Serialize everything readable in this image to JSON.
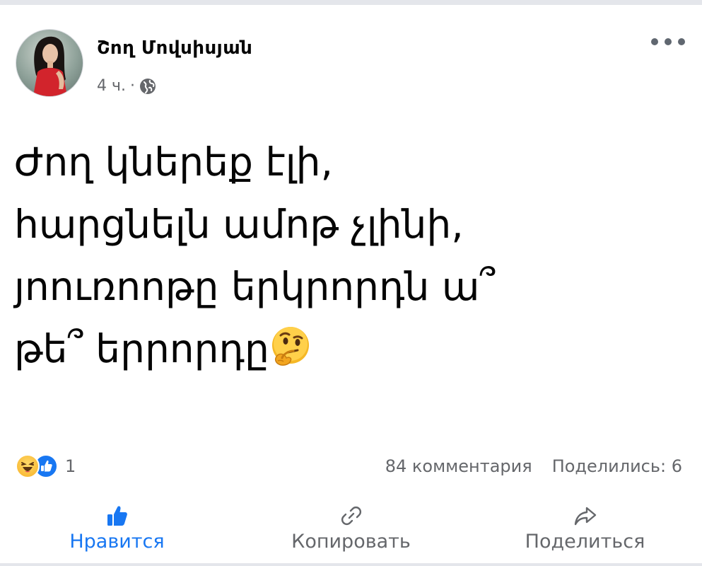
{
  "post": {
    "author": "Շող Մովսիսյան",
    "time": "4 ч.",
    "separator": "·",
    "text_lines": [
      "Ժող կներեք էլի,",
      "հարցնելն ամոթ չլինի,",
      "յոուռոոթը երկրորդն ա՞",
      "թե՞ երրորդը"
    ]
  },
  "stats": {
    "reaction_count": "1",
    "comments": "84 комментария",
    "shares": "Поделились: 6"
  },
  "actions": {
    "like": "Нравится",
    "copy": "Копировать",
    "share": "Поделиться"
  },
  "icons": {
    "menu": "more-horizontal-icon",
    "privacy": "globe-icon",
    "post_emoji": "thinking-face-emoji",
    "reaction_1": "haha-reaction-icon",
    "reaction_2": "like-reaction-icon",
    "like_action": "thumbs-up-icon",
    "copy_action": "link-icon",
    "share_action": "share-arrow-icon"
  },
  "colors": {
    "accent": "#1877f2",
    "secondary_text": "#65676b",
    "primary_text": "#050505"
  }
}
